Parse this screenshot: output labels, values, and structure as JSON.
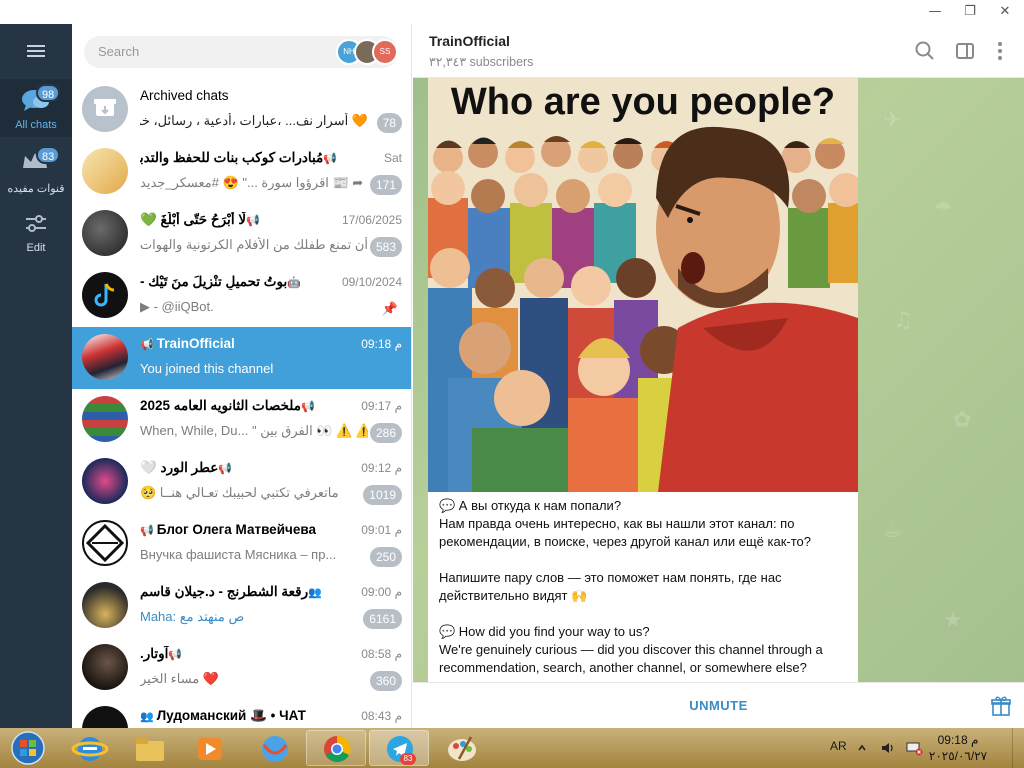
{
  "window": {
    "minimize": "—",
    "maximize": "❐",
    "close": "✕"
  },
  "nav": {
    "menu_icon": "hamburger-icon",
    "items": [
      {
        "label": "All chats",
        "badge": "98",
        "icon": "chat-bubbles-icon"
      },
      {
        "label": "قنوات مفيده",
        "badge": "83",
        "icon": "crown-folder-icon"
      },
      {
        "label": "Edit",
        "icon": "sliders-icon"
      }
    ]
  },
  "search": {
    "placeholder": "Search",
    "avatars": [
      "NH",
      "",
      "SS"
    ]
  },
  "chats": [
    {
      "name": "Archived chats",
      "preview": "🧡 أسرار نف... ،عبارات ،أدعية ، رسائل، خواطر",
      "badge": "78",
      "time": ""
    },
    {
      "name": "مُبادرات كوكب بنات للحفظ والتدبر",
      "preview": "➦ 📰 اقرؤوا سورة ...\" 😍 #معسكر_جديد",
      "time": "Sat",
      "badge": "171"
    },
    {
      "name": "لَا أَبْرَحُ حَتّى أَبْلُغَ 💚",
      "preview": "أن تمنع طفلك من الأفلام الكرتونية والهوات...",
      "time": "17/06/2025",
      "badge": "583"
    },
    {
      "name": "بوتُ تحميلِ تنْزيلَ منَ تَيْك -",
      "preview": "▶ - @iiQBot.",
      "time": "09/10/2024",
      "badge": ""
    },
    {
      "name": "TrainOfficial",
      "preview": "You joined this channel",
      "time": "09:18 م",
      "badge": ""
    },
    {
      "name": "ملخصات الثانويه العامه 2025",
      "preview": "When, While, Du... \" الفرق بين 👀 ⚠️ ⚠️",
      "time": "09:17 م",
      "badge": "286"
    },
    {
      "name": "عطر الورد 🤍",
      "preview": "ماتعرفي تكتبي لحبيبك تعـالي هنــا 🥺",
      "time": "09:12 م",
      "badge": "1019"
    },
    {
      "name": "Блог Олега Матвейчева",
      "preview": "Внучка фашиста Мясника – пр...",
      "time": "09:01 م",
      "badge": "250"
    },
    {
      "name": "رقعة الشطرنج - د.جيلان قاسم",
      "preview": "Maha: ص منهتد مع",
      "time": "09:00 م",
      "badge": "6161"
    },
    {
      "name": "آوتار.",
      "preview": "❤️ مساء الخير",
      "time": "08:58 م",
      "badge": "360"
    },
    {
      "name": "Лудоманский 🎩 • ЧАТ",
      "preview": "",
      "time": "08:43 م",
      "badge": ""
    }
  ],
  "header": {
    "title": "TrainOfficial",
    "subtitle": "٣٢,٣٤٣ subscribers"
  },
  "post": {
    "image_headline": "Who are you people?",
    "lines": [
      "💬 А вы откуда к нам попали?",
      "Нам правда очень интересно, как вы нашли этот канал: по рекомендации, в поиске, через другой канал или ещё как-то?",
      "",
      "Напишите пару слов — это поможет нам понять, где нас действительно видят 🙌",
      "",
      "💬 How did you find your way to us?",
      "We're genuinely curious — did you discover this channel through a recommendation, search, another channel, or somewhere else?"
    ]
  },
  "bottom": {
    "unmute": "UNMUTE"
  },
  "taskbar": {
    "apps": [
      "internet-explorer-icon",
      "file-explorer-icon",
      "media-player-icon",
      "globe-app-icon",
      "chrome-icon",
      "telegram-icon",
      "paint-icon"
    ],
    "telegram_badge": "83",
    "lang": "AR",
    "time": "09:18 م",
    "date": "٢٠٢٥/٠٦/٢٧"
  },
  "colors": {
    "accent": "#419fd9",
    "nav_bg": "#263544",
    "badge": "#b7bec5",
    "unmute": "#3a8bc6"
  }
}
